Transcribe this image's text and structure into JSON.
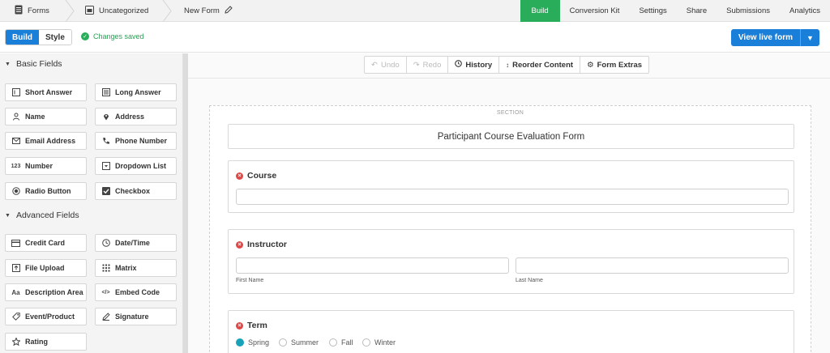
{
  "breadcrumb": {
    "forms": "Forms",
    "category": "Uncategorized",
    "form_name": "New Form"
  },
  "topnav": [
    {
      "label": "Build",
      "active": true
    },
    {
      "label": "Conversion Kit"
    },
    {
      "label": "Settings"
    },
    {
      "label": "Share"
    },
    {
      "label": "Submissions"
    },
    {
      "label": "Analytics"
    }
  ],
  "toolbar": {
    "build_label": "Build",
    "style_label": "Style",
    "saved_text": "Changes saved",
    "live_label": "View live form"
  },
  "sidebar": {
    "basic_title": "Basic Fields",
    "basic": [
      {
        "label": "Short Answer",
        "icon": "short-answer-icon"
      },
      {
        "label": "Long Answer",
        "icon": "long-answer-icon"
      },
      {
        "label": "Name",
        "icon": "person-icon"
      },
      {
        "label": "Address",
        "icon": "map-pin-icon"
      },
      {
        "label": "Email Address",
        "icon": "envelope-icon"
      },
      {
        "label": "Phone Number",
        "icon": "phone-icon"
      },
      {
        "label": "Number",
        "icon": "number-icon"
      },
      {
        "label": "Dropdown List",
        "icon": "dropdown-icon"
      },
      {
        "label": "Radio Button",
        "icon": "radio-icon"
      },
      {
        "label": "Checkbox",
        "icon": "checkbox-icon"
      }
    ],
    "advanced_title": "Advanced Fields",
    "advanced": [
      {
        "label": "Credit Card",
        "icon": "credit-card-icon"
      },
      {
        "label": "Date/Time",
        "icon": "clock-icon"
      },
      {
        "label": "File Upload",
        "icon": "upload-icon"
      },
      {
        "label": "Matrix",
        "icon": "grid-icon"
      },
      {
        "label": "Description Area",
        "icon": "text-icon"
      },
      {
        "label": "Embed Code",
        "icon": "code-icon"
      },
      {
        "label": "Event/Product",
        "icon": "tag-icon"
      },
      {
        "label": "Signature",
        "icon": "pen-icon"
      },
      {
        "label": "Rating",
        "icon": "star-icon"
      }
    ]
  },
  "canvas_toolbar": {
    "undo": "Undo",
    "redo": "Redo",
    "history": "History",
    "reorder": "Reorder Content",
    "extras": "Form Extras"
  },
  "form": {
    "section_label": "SECTION",
    "title": "Participant Course Evaluation Form",
    "course_label": "Course",
    "instructor_label": "Instructor",
    "first_name": "First Name",
    "last_name": "Last Name",
    "term_label": "Term",
    "term_options": [
      "Spring",
      "Summer",
      "Fall",
      "Winter"
    ],
    "term_selected": "Spring"
  },
  "colors": {
    "accent": "#1a7fd8",
    "build_active": "#2aad5a",
    "required": "#e04848",
    "radio_selected": "#17a2b8"
  }
}
